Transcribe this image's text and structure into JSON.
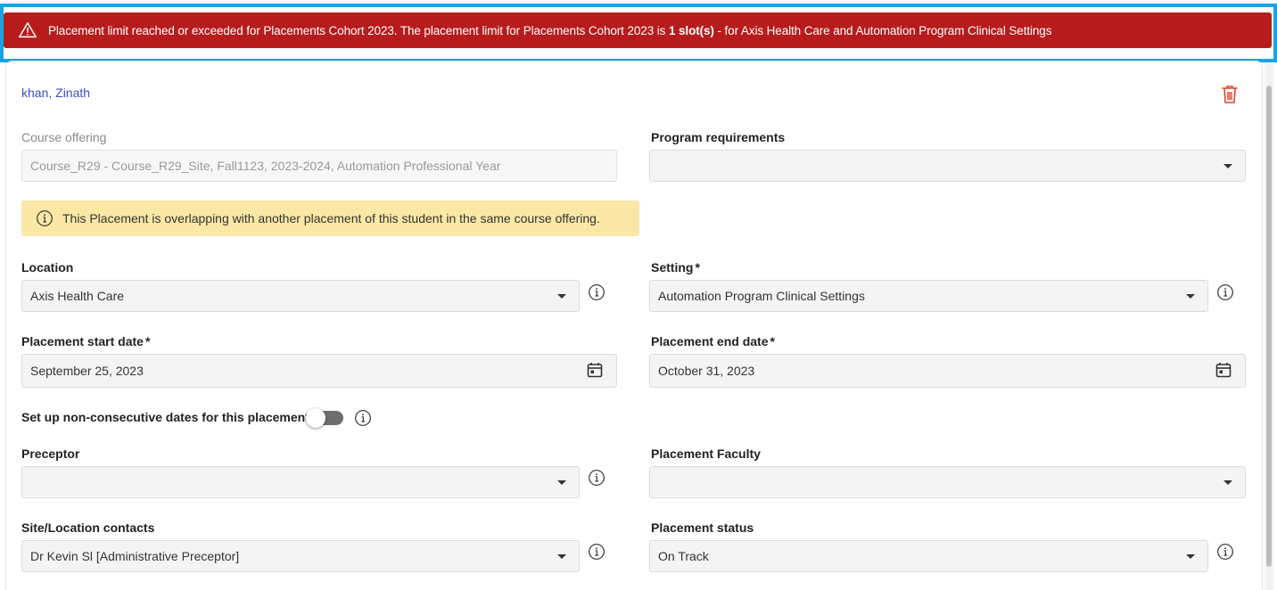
{
  "alert": {
    "text_before": "Placement limit reached or exceeded for Placements Cohort 2023. The placement limit for Placements Cohort 2023 is ",
    "text_bold": "1 slot(s)",
    "text_after": " - for Axis Health Care and Automation Program Clinical Settings",
    "icon": "warning-icon",
    "color": "#b71c1c",
    "frame_color": "#1aa3e3"
  },
  "student": {
    "name": "khan, Zinath",
    "delete_icon": "trash-icon"
  },
  "course_offering": {
    "label": "Course offering",
    "value": "Course_R29 - Course_R29_Site, Fall1123, 2023-2024, Automation Professional Year"
  },
  "program_requirements": {
    "label": "Program requirements",
    "value": ""
  },
  "overlap_notice": {
    "text": "This Placement is overlapping with another placement of this student in the same course offering.",
    "color": "#fbe8a6"
  },
  "location": {
    "label": "Location",
    "value": "Axis Health Care"
  },
  "setting": {
    "label": "Setting",
    "required": "*",
    "value": "Automation Program Clinical Settings"
  },
  "start_date": {
    "label": "Placement start date",
    "required": "*",
    "value": "September 25, 2023"
  },
  "end_date": {
    "label": "Placement end date",
    "required": "*",
    "value": "October 31, 2023"
  },
  "non_consecutive": {
    "label": "Set up non-consecutive dates for this placement",
    "enabled": false
  },
  "preceptor": {
    "label": "Preceptor",
    "value": ""
  },
  "placement_faculty": {
    "label": "Placement Faculty",
    "value": ""
  },
  "site_contacts": {
    "label": "Site/Location contacts",
    "value": "Dr Kevin Sl [Administrative Preceptor]"
  },
  "placement_status": {
    "label": "Placement status",
    "value": "On Track"
  }
}
